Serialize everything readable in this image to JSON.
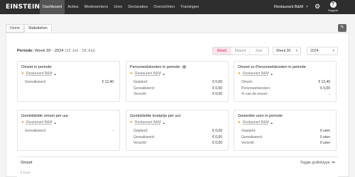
{
  "app": {
    "logo": "EINSTEIN",
    "nav": [
      "Dashboard",
      "Acties",
      "Medewerkers",
      "Uren",
      "Declaraties",
      "Overzichten",
      "Trainingen"
    ],
    "restaurant": "Restaurant B&M",
    "support": "Support"
  },
  "tabs": [
    "Home",
    "Statistieken"
  ],
  "filters": {
    "period_label": "Periode:",
    "period_value": "Week 30 - 2024",
    "period_range": "(22 Juli - 28 Juli)",
    "segments": [
      "Week",
      "Maand",
      "Jaar"
    ],
    "week_select": "Week 30",
    "year_select": "2024"
  },
  "cards": [
    {
      "title": "Omzet in periode",
      "location": "Restaurant B&M",
      "info": false,
      "rows": [
        {
          "label": "Gerealiseerd:",
          "value": "€ 12,40"
        }
      ]
    },
    {
      "title": "Personeelskosten in periode",
      "location": "Restaurant B&M",
      "info": true,
      "rows": [
        {
          "label": "Gepland:",
          "value": "€ 0,00"
        },
        {
          "label": "Gerealiseerd:",
          "value": "€ 0,00"
        },
        {
          "label": "Verschil:",
          "value": "€ 0,00"
        }
      ]
    },
    {
      "title": "Omzet vs Personeelskosten in periode",
      "location": "Restaurant B&M",
      "info": false,
      "rows": [
        {
          "label": "Omzet:",
          "value": "€ 12,40"
        },
        {
          "label": "Personeelskosten:",
          "value": "€ 0,00"
        },
        {
          "label": "% van de omzet:",
          "value": "-"
        }
      ]
    },
    {
      "title": "Gemiddelde omzet per uur",
      "location": "Restaurant B&M",
      "info": false,
      "rows": [
        {
          "label": "Gerealiseerd:",
          "value": "-"
        }
      ]
    },
    {
      "title": "Gemiddelde kostprijs per uur",
      "location": "Restaurant B&M",
      "info": false,
      "rows": [
        {
          "label": "Gepland:",
          "value": "€ 0,00"
        },
        {
          "label": "Gerealiseerd:",
          "value": "€ 0,00"
        },
        {
          "label": "Verschil:",
          "value": "€ 0,00"
        }
      ]
    },
    {
      "title": "Gewerkte uren in periode",
      "location": "Restaurant B&M",
      "info": false,
      "rows": [
        {
          "label": "Gepland:",
          "value": "0 uren"
        },
        {
          "label": "Gerealiseerd:",
          "value": "0 uren"
        },
        {
          "label": "Verschil:",
          "value": "0 uren"
        }
      ]
    }
  ],
  "chart": {
    "title": "Omzet",
    "toggle_label": "Toggle grafiektype",
    "first_tick": "€ 14,00"
  }
}
